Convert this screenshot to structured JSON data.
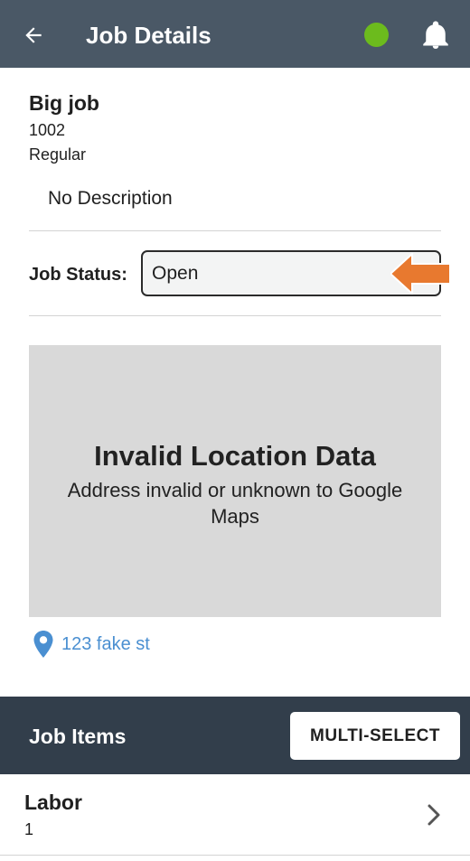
{
  "header": {
    "title": "Job Details",
    "status_dot_color": "#6cbb1d",
    "back_icon": "arrow-left-icon",
    "bell_icon": "bell-icon"
  },
  "job": {
    "name": "Big job",
    "number": "1002",
    "type": "Regular",
    "description": "No Description"
  },
  "status": {
    "label": "Job Status:",
    "value": "Open",
    "arrow_color": "#e8792f"
  },
  "map": {
    "title": "Invalid Location Data",
    "message": "Address invalid or unknown to Google Maps"
  },
  "address": {
    "icon": "map-pin-icon",
    "text": "123 fake st",
    "color": "#4a8fd1"
  },
  "job_items": {
    "title": "Job Items",
    "multi_select_label": "MULTI-SELECT",
    "items": [
      {
        "name": "Labor",
        "quantity": "1"
      }
    ]
  }
}
